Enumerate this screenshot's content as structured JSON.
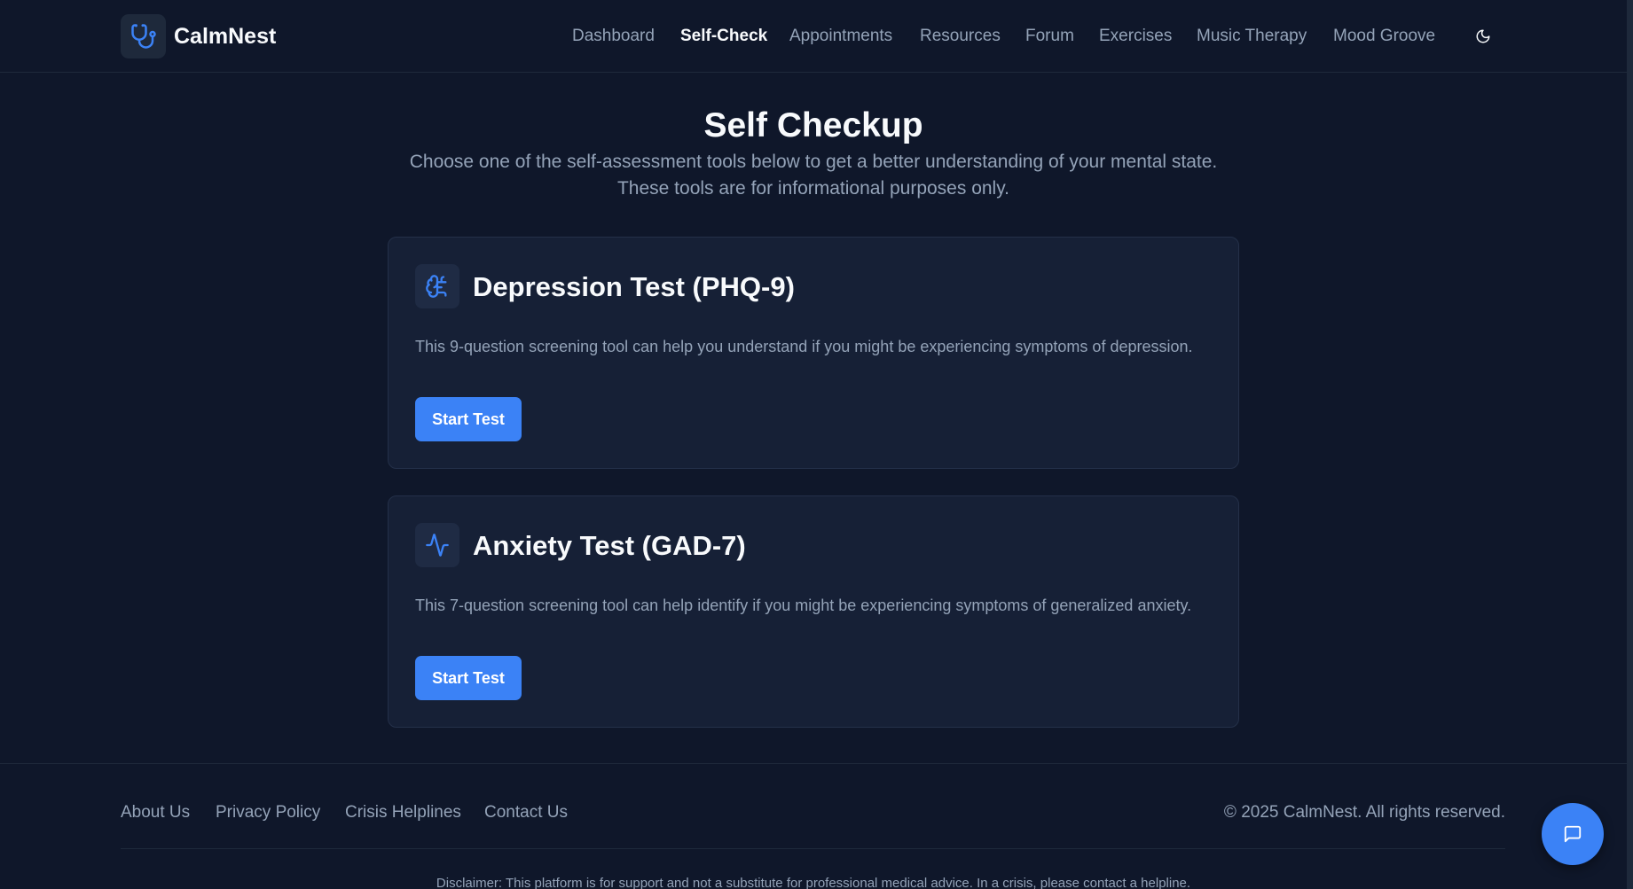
{
  "brand": {
    "name": "CalmNest",
    "icon": "stethoscope-icon"
  },
  "nav": {
    "items": [
      {
        "label": "Dashboard",
        "active": false
      },
      {
        "label": "Self-Check",
        "active": true
      },
      {
        "label": "Appointments",
        "active": false
      },
      {
        "label": "Resources",
        "active": false
      },
      {
        "label": "Forum",
        "active": false
      },
      {
        "label": "Exercises",
        "active": false
      },
      {
        "label": "Music Therapy",
        "active": false
      },
      {
        "label": "Mood Groove",
        "active": false
      }
    ],
    "theme_toggle_icon": "moon-icon"
  },
  "main": {
    "title": "Self Checkup",
    "subtitle_line1": "Choose one of the self-assessment tools below to get a better understanding of your mental state.",
    "subtitle_line2": "These tools are for informational purposes only.",
    "cards": [
      {
        "icon": "brain-icon",
        "title": "Depression Test (PHQ-9)",
        "description": "This 9-question screening tool can help you understand if you might be experiencing symptoms of depression.",
        "button_label": "Start Test"
      },
      {
        "icon": "activity-icon",
        "title": "Anxiety Test (GAD-7)",
        "description": "This 7-question screening tool can help identify if you might be experiencing symptoms of generalized anxiety.",
        "button_label": "Start Test"
      }
    ]
  },
  "footer": {
    "links": [
      "About Us",
      "Privacy Policy",
      "Crisis Helplines",
      "Contact Us"
    ],
    "copyright": "© 2025 CalmNest. All rights reserved.",
    "disclaimer": "Disclaimer: This platform is for support and not a substitute for professional medical advice. In a crisis, please contact a helpline."
  },
  "chat_button": {
    "icon": "message-icon"
  },
  "colors": {
    "background": "#0f172a",
    "card": "#162036",
    "accent": "#3b82f6",
    "text_muted": "#94a3b8",
    "text_primary": "#f8fafc"
  }
}
